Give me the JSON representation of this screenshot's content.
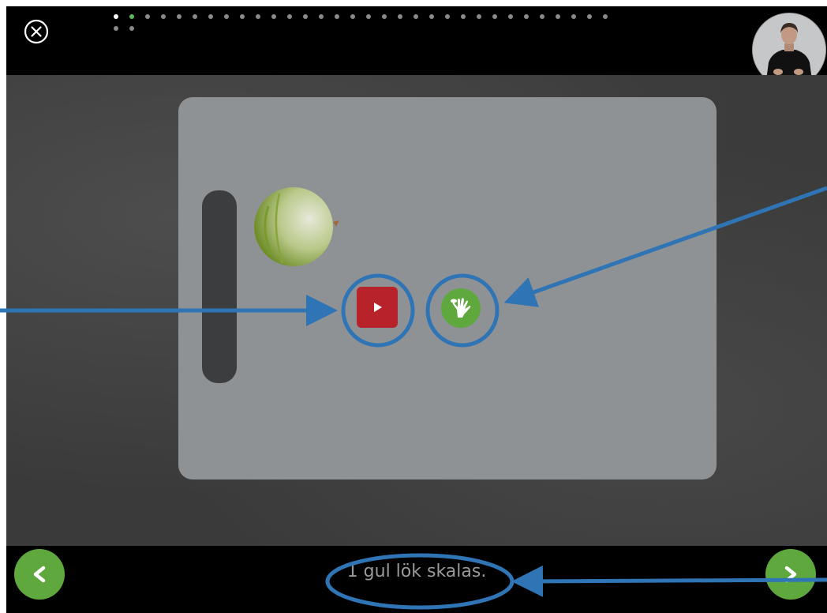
{
  "progress": {
    "total_steps": 34,
    "completed_steps": 1,
    "current_step": 2
  },
  "step": {
    "caption": "1 gul lök skalas."
  },
  "controls": {
    "close_icon": "close-icon",
    "prev_icon": "chevron-left-icon",
    "next_icon": "chevron-right-icon",
    "video_icon": "play-icon",
    "sign_icon": "sign-language-hand-icon"
  },
  "colors": {
    "accent_green": "#5ea83e",
    "video_red": "#b8232b",
    "annotation_blue": "#2f74b5"
  }
}
